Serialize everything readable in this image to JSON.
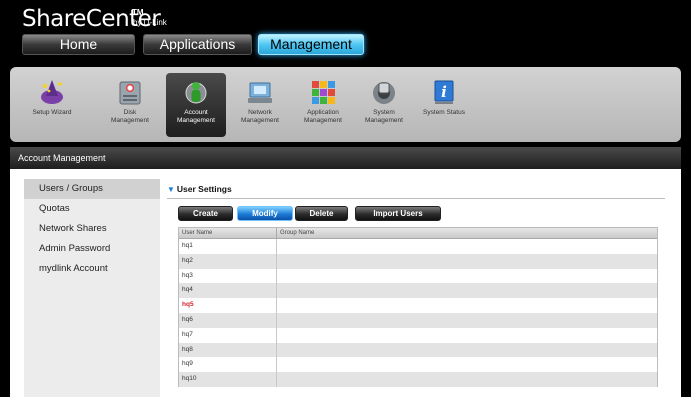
{
  "header": {
    "brand": "ShareCenter",
    "brand_tm": "TM",
    "brand_by": "by D-Link",
    "tabs": [
      {
        "label": "Home"
      },
      {
        "label": "Applications"
      },
      {
        "label": "Management"
      }
    ],
    "active_tab": "Management"
  },
  "iconbar": {
    "items": [
      {
        "label1": "Setup Wizard",
        "label2": "",
        "icon": "wizard-icon"
      },
      {
        "label1": "Disk",
        "label2": "Management",
        "icon": "disk-icon"
      },
      {
        "label1": "Account",
        "label2": "Management",
        "icon": "account-icon"
      },
      {
        "label1": "Network",
        "label2": "Management",
        "icon": "network-icon"
      },
      {
        "label1": "Application",
        "label2": "Management",
        "icon": "application-icon"
      },
      {
        "label1": "System",
        "label2": "Management",
        "icon": "system-icon"
      },
      {
        "label1": "System Status",
        "label2": "",
        "icon": "info-icon"
      }
    ],
    "active_item": "Account Management"
  },
  "panel": {
    "title": "Account Management"
  },
  "sidebar": {
    "items": [
      {
        "label": "Users / Groups"
      },
      {
        "label": "Quotas"
      },
      {
        "label": "Network Shares"
      },
      {
        "label": "Admin Password"
      },
      {
        "label": "mydlink Account"
      }
    ],
    "active_item": "Users / Groups"
  },
  "content": {
    "section_title": "User Settings",
    "buttons": {
      "create": "Create",
      "modify": "Modify",
      "delete": "Delete",
      "import": "Import Users"
    },
    "table": {
      "headers": {
        "user": "User Name",
        "group": "Group Name"
      },
      "rows": [
        {
          "user": "hq1",
          "group": ""
        },
        {
          "user": "hq2",
          "group": ""
        },
        {
          "user": "hq3",
          "group": ""
        },
        {
          "user": "hq4",
          "group": ""
        },
        {
          "user": "hq5",
          "group": ""
        },
        {
          "user": "hq6",
          "group": ""
        },
        {
          "user": "hq7",
          "group": ""
        },
        {
          "user": "hq8",
          "group": ""
        },
        {
          "user": "hq9",
          "group": ""
        },
        {
          "user": "hq10",
          "group": ""
        }
      ],
      "selected_row": "hq5"
    }
  },
  "colors": {
    "active_tab": "#4fc7f2",
    "modify_button": "#1b7bd6",
    "selected_text": "#d0242a"
  }
}
